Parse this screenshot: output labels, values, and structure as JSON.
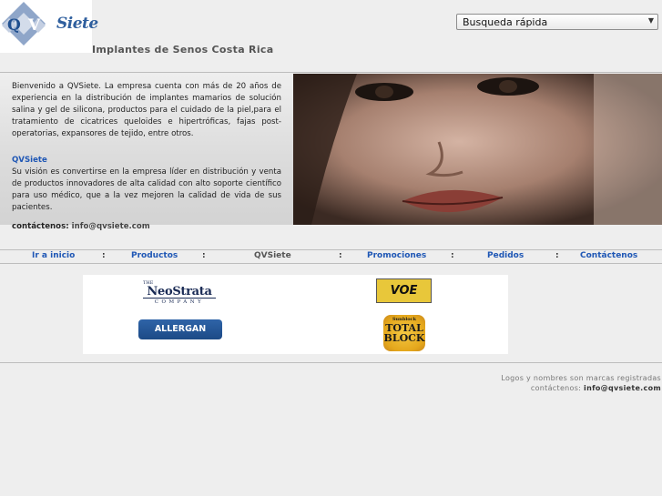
{
  "logo": {
    "text": "QVSiete",
    "wordmark": "Siete"
  },
  "site_title": "Implantes de Senos Costa Rica",
  "search": {
    "selected": "Busqueda rápida"
  },
  "intro": {
    "text": "Bienvenido a QVSiete. La empresa cuenta con más de 20 años de experiencia en la distribución de implantes mamarios de solución salina y gel de silicona, productos para el cuidado de la piel,para el tratamiento de cicatrices queloides e hipertróficas, fajas post-operatorias, expansores de tejido, entre otros.",
    "heading": "QVSiete",
    "vision": "Su visión es convertirse en la empresa líder en distribución y venta de productos innovadores de alta calidad con alto soporte científico para uso médico, que a la vez mejoren la calidad de vida de sus pacientes.",
    "contact_label": "contáctenos:",
    "contact_email": "info@qvsiete.com"
  },
  "nav": {
    "separator": ":",
    "items": [
      {
        "label": "Ir a inicio"
      },
      {
        "label": "Productos"
      },
      {
        "label": "QVSiete"
      },
      {
        "label": "Promociones"
      },
      {
        "label": "Pedidos"
      },
      {
        "label": "Contáctenos"
      }
    ]
  },
  "brands": {
    "neostrata": {
      "the": "THE",
      "main": "NeoStrata",
      "company": "COMPANY"
    },
    "voe": "VOE",
    "allergan": "ALLERGAN",
    "totalblock": {
      "top": "Sunblock",
      "line1": "TOTAL",
      "line2": "BLOCK"
    }
  },
  "footer": {
    "trademark": "Logos y nombres son marcas registradas",
    "contact_label": "contáctenos:",
    "contact_email": "info@qvsiete.com"
  }
}
